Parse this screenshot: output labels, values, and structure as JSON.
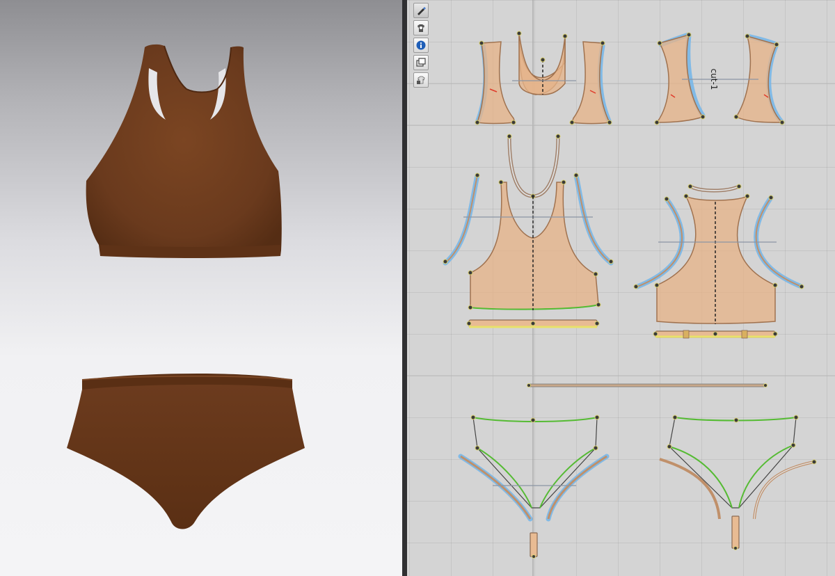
{
  "app": {
    "panels": [
      "3d-garment-view",
      "2d-pattern-view"
    ],
    "garment_color": "#6a3a1d"
  },
  "toolbar": {
    "tools": [
      {
        "icon": "pen-tool-icon",
        "active": true
      },
      {
        "icon": "eye-shirt-icon",
        "active": false
      },
      {
        "icon": "info-icon",
        "active": false
      },
      {
        "icon": "layers-icon",
        "active": false
      },
      {
        "icon": "lock-shirt-icon",
        "active": false
      }
    ]
  },
  "pattern": {
    "pieces": [
      "armhole-binding-front",
      "neck-binding-front",
      "sleeve-binding-back",
      "bra-front",
      "bra-back",
      "underband-front",
      "underband-back",
      "waistband",
      "brief-front",
      "brief-back",
      "gusset"
    ],
    "label_cut": "cut-1"
  },
  "colors": {
    "piece_fill": "#e6b489",
    "seam_highlight": "#78b7e8",
    "edge_green": "#55bb33",
    "axis": "#8b95a3"
  }
}
